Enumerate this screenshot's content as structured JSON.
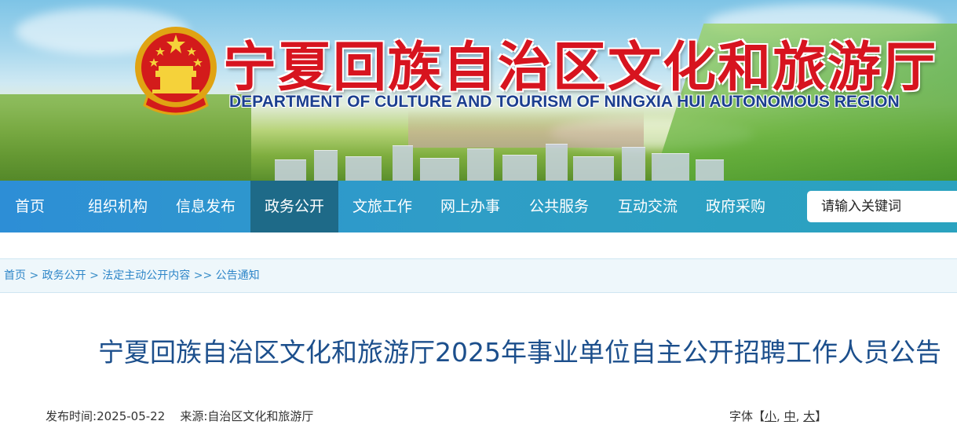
{
  "header": {
    "title_cn": "宁夏回族自治区文化和旅游厅",
    "title_en": "DEPARTMENT OF CULTURE AND TOURISM OF NINGXIA HUI AUTONOMOUS REGION",
    "emblem_icon": "national-emblem-icon",
    "title_color": "#d7141f",
    "subtitle_color": "#1c3f8f"
  },
  "nav": {
    "items": [
      {
        "label": "首页"
      },
      {
        "label": "组织机构"
      },
      {
        "label": "信息发布"
      },
      {
        "label": "政务公开",
        "active": true
      },
      {
        "label": "文旅工作"
      },
      {
        "label": "网上办事"
      },
      {
        "label": "公共服务"
      },
      {
        "label": "互动交流"
      },
      {
        "label": "政府采购"
      }
    ],
    "background": "#2d8ed6",
    "active_background": "#1e6a88"
  },
  "search": {
    "placeholder": "请输入关键词"
  },
  "breadcrumb": {
    "items": [
      "首页",
      "政务公开",
      "法定主动公开内容",
      "公告通知"
    ],
    "separators": [
      ">",
      ">",
      ">>"
    ],
    "link_color": "#2e86c8"
  },
  "article": {
    "title": "宁夏回族自治区文化和旅游厅2025年事业单位自主公开招聘工作人员公告",
    "publish_label": "发布时间:",
    "publish_date": "2025-05-22",
    "source_label": "来源:",
    "source": "自治区文化和旅游厅",
    "title_color": "#1c4f8c"
  },
  "font_size": {
    "label": "字体【",
    "small": "小",
    "medium": "中",
    "large": "大",
    "comma": ",",
    "close": "】"
  }
}
